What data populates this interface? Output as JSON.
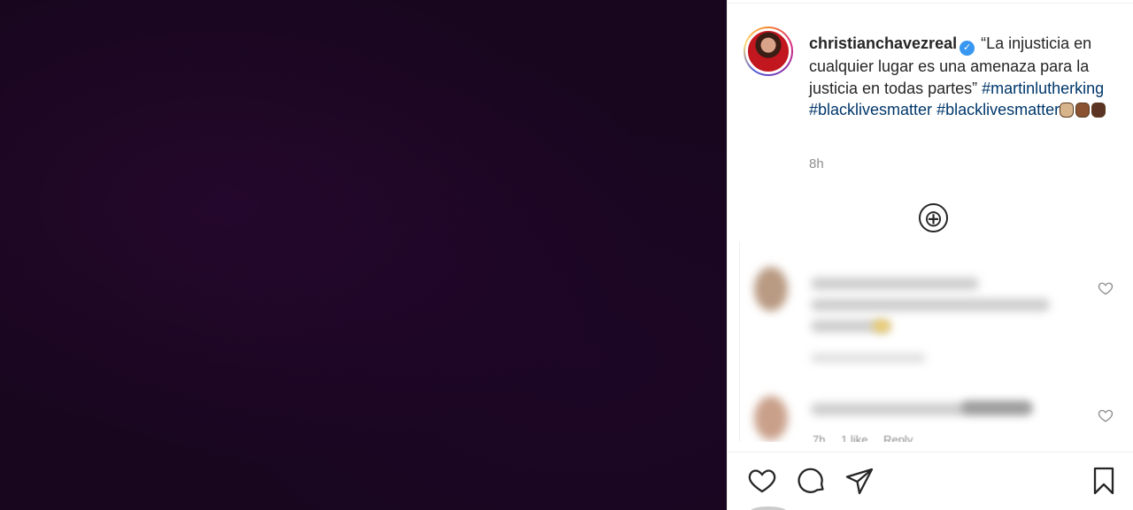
{
  "post": {
    "username": "christianchavezreal",
    "verified_mark": "✓",
    "caption_text": " “La injusticia en cualquier lugar es una amenaza para la justicia en todas partes” ",
    "hashtags": [
      "#martinlutherking",
      "#blacklivesmatter",
      "#blacklivesmatter"
    ],
    "emojis": [
      "raised-fist-light",
      "raised-fist-medium-dark",
      "raised-fist-dark"
    ],
    "time": "8h"
  },
  "load_more": {
    "icon": "⊕"
  },
  "comments": {
    "items": [
      {
        "blurred": true,
        "meta": [
          "7h",
          "1 like",
          "Reply"
        ]
      },
      {
        "blurred": true,
        "meta": [
          "7h",
          "1 like",
          "Reply"
        ]
      }
    ],
    "visible_meta": [
      "7h",
      "1 like",
      "Reply"
    ]
  },
  "actions": {
    "like": "heart-icon",
    "comment": "comment-icon",
    "share": "paper-plane-icon",
    "save": "bookmark-icon"
  },
  "colors": {
    "media_bg": "#17061d",
    "hashtag": "#00376b",
    "verified": "#3897f0",
    "muted": "#8e8e8e"
  }
}
